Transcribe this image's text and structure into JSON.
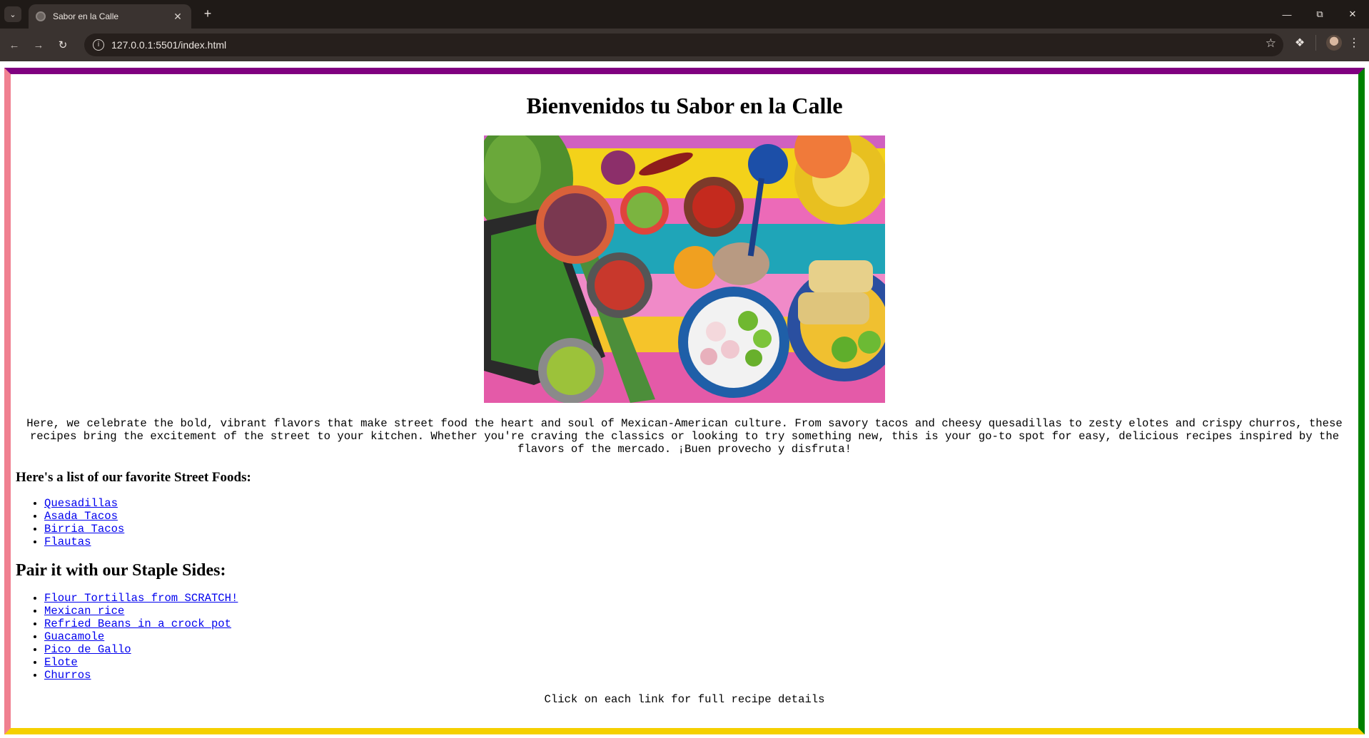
{
  "browser": {
    "tab_title": "Sabor en la Calle",
    "url": "127.0.0.1:5501/index.html",
    "icons": {
      "tab_search": "chevron-down-icon",
      "tab_close": "close-icon",
      "new_tab": "plus-icon",
      "back": "arrow-left-icon",
      "forward": "arrow-right-icon",
      "reload": "reload-icon",
      "site_info": "info-icon",
      "bookmark": "star-icon",
      "extensions": "puzzle-icon",
      "menu": "kebab-menu-icon",
      "minimize": "minimize-icon",
      "restore": "restore-icon",
      "close_window": "close-icon"
    }
  },
  "page": {
    "border_colors": {
      "top": "#800080",
      "right": "#008000",
      "bottom": "#f5d000",
      "left": "#f08090"
    },
    "title": "Bienvenidos tu Sabor en la Calle",
    "intro": "Here, we celebrate the bold, vibrant flavors that make street food the heart and soul of Mexican-American culture. From savory tacos and cheesy quesadillas to zesty elotes and crispy churros, these recipes bring the excitement of the street to your kitchen. Whether you're craving the classics or looking to try something new, this is your go-to spot for easy, delicious recipes inspired by the flavors of the mercado. ¡Buen provecho y disfruta!",
    "street_foods_heading": "Here's a list of our favorite Street Foods:",
    "street_foods": [
      "Quesadillas",
      "Asada Tacos",
      "Birria Tacos",
      "Flautas"
    ],
    "sides_heading": "Pair it with our Staple Sides:",
    "sides": [
      "Flour Tortillas from SCRATCH!",
      "Mexican rice",
      "Refried Beans in a crock pot",
      "Guacamole",
      "Pico de Gallo",
      "Elote",
      "Churros"
    ],
    "footer_note": "Click on each link for full recipe details",
    "link_color": "#0000ee"
  }
}
